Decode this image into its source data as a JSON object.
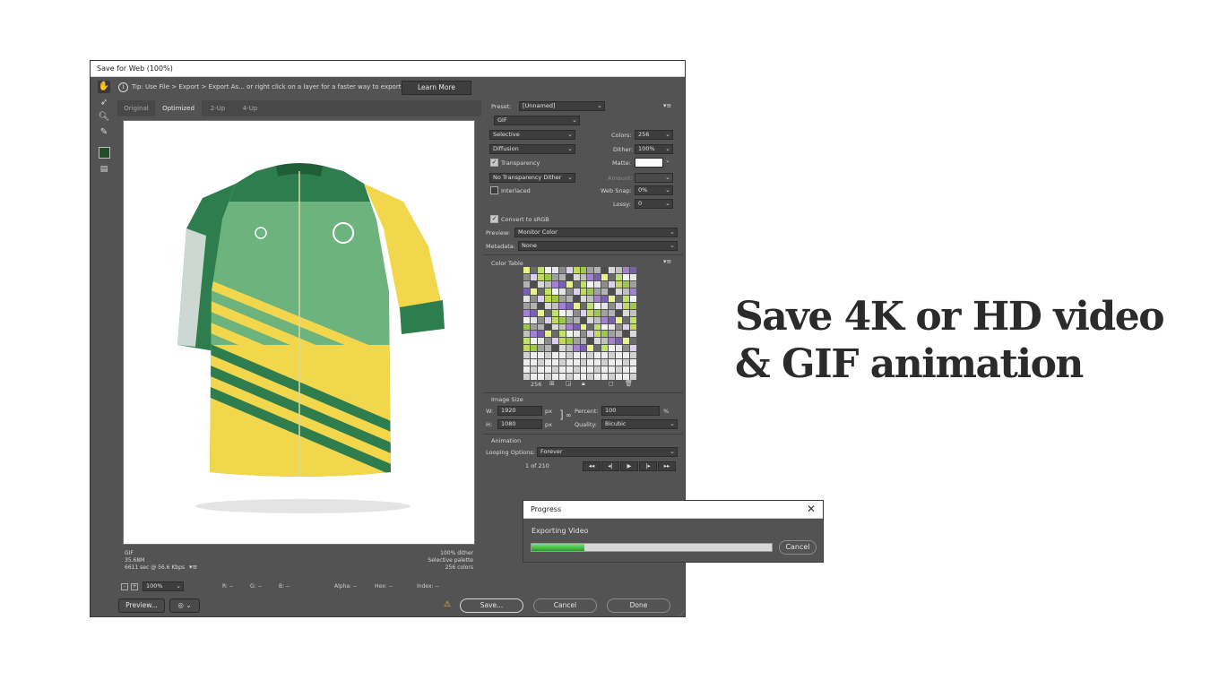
{
  "window": {
    "title": "Save for Web (100%)"
  },
  "tip": {
    "text": "Tip: Use File > Export > Export As...  or right click on a layer for a faster way to export assets",
    "learn_more": "Learn More"
  },
  "tabs": [
    {
      "label": "Original"
    },
    {
      "label": "Optimized"
    },
    {
      "label": "2-Up"
    },
    {
      "label": "4-Up"
    }
  ],
  "canvas_info": {
    "format": "GIF",
    "size": "35.68M",
    "time": "6611 sec @ 56.6 Kbps",
    "dither": "100% dither",
    "palette": "Selective palette",
    "colors": "256 colors"
  },
  "statusbar": {
    "zoom": "100%",
    "r": "R: --",
    "g": "G: --",
    "b": "B: --",
    "alpha": "Alpha: --",
    "hex": "Hex: --",
    "index": "Index: --"
  },
  "bottom": {
    "preview": "Preview...",
    "save": "Save...",
    "cancel": "Cancel",
    "done": "Done"
  },
  "settings": {
    "preset_label": "Preset:",
    "preset_value": "[Unnamed]",
    "format": "GIF",
    "reduction": "Selective",
    "colors_label": "Colors:",
    "colors_value": "256",
    "dither_algo": "Diffusion",
    "dither_label": "Dither:",
    "dither_value": "100%",
    "transparency_label": "Transparency",
    "matte_label": "Matte:",
    "transparency_dither": "No Transparency Dither",
    "amount_label": "Amount:",
    "interlaced_label": "Interlaced",
    "websnap_label": "Web Snap:",
    "websnap_value": "0%",
    "lossy_label": "Lossy:",
    "lossy_value": "0",
    "convert_srgb_label": "Convert to sRGB",
    "preview_label": "Preview:",
    "preview_value": "Monitor Color",
    "metadata_label": "Metadata:",
    "metadata_value": "None"
  },
  "color_table": {
    "title": "Color Table",
    "count": "256"
  },
  "image_size": {
    "title": "Image Size",
    "w_label": "W:",
    "w_value": "1920",
    "w_unit": "px",
    "h_label": "H:",
    "h_value": "1080",
    "h_unit": "px",
    "percent_label": "Percent:",
    "percent_value": "100",
    "percent_unit": "%",
    "quality_label": "Quality:",
    "quality_value": "Bicubic"
  },
  "animation": {
    "title": "Animation",
    "looping_label": "Looping Options:",
    "looping_value": "Forever",
    "frame": "1 of 210"
  },
  "progress": {
    "title": "Progress",
    "status": "Exporting Video",
    "cancel": "Cancel",
    "fraction": 0.22
  },
  "headline": {
    "line1": "Save 4K or HD video",
    "line2": "& GIF animation"
  },
  "colors": {
    "dialog_bg": "#535353",
    "jersey_green": "#2e7d4f",
    "jersey_yellow": "#f2d64b",
    "progress_green": "#1fa01f"
  }
}
